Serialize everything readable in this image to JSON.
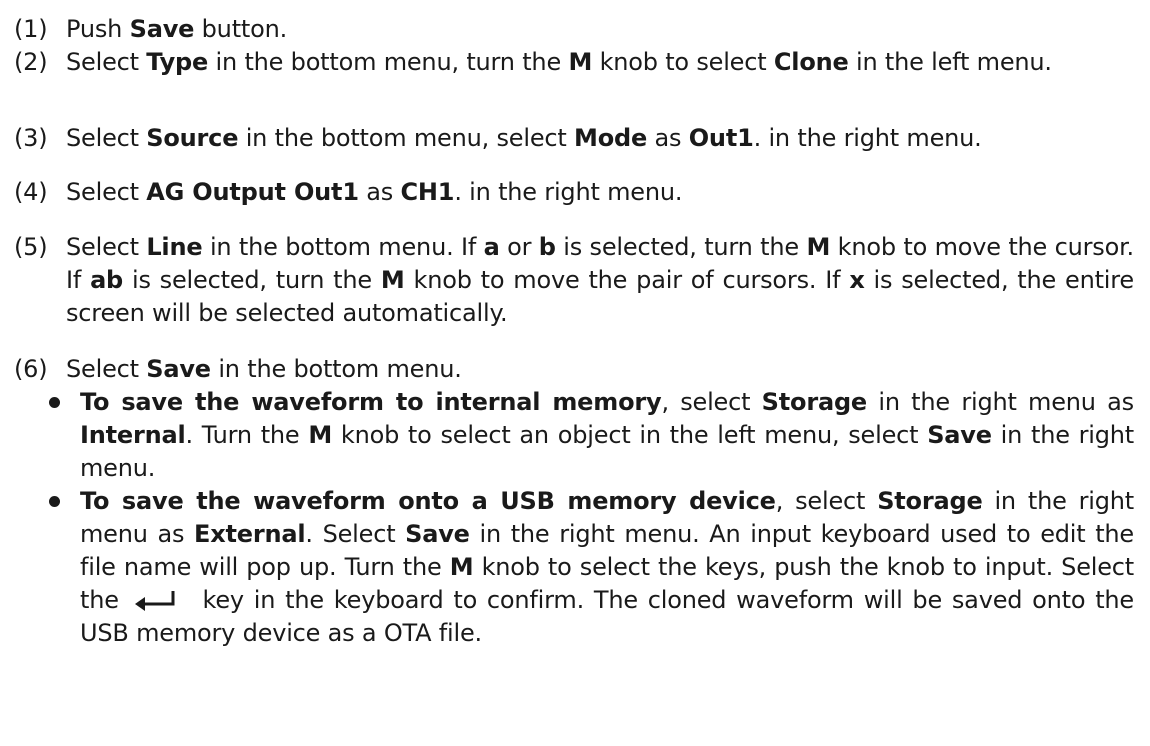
{
  "steps": [
    {
      "num": "(1)",
      "parts": [
        "Push ",
        "Save",
        " button."
      ]
    },
    {
      "num": "(2)",
      "parts": [
        "Select ",
        "Type",
        " in the bottom menu, turn the ",
        "M",
        " knob to select ",
        "Clone",
        " in the left menu."
      ]
    },
    {
      "num": "(3)",
      "parts": [
        "Select ",
        "Source",
        " in the bottom menu, select ",
        "Mode",
        " as ",
        "Out1",
        ". in the right menu."
      ]
    },
    {
      "num": "(4)",
      "parts": [
        "Select ",
        "AG Output Out1",
        " as ",
        "CH1",
        ". in the right menu."
      ]
    },
    {
      "num": "(5)",
      "parts": [
        "Select ",
        "Line",
        " in the bottom menu. If ",
        "a",
        " or ",
        "b",
        " is selected, turn the ",
        "M",
        " knob to move the cursor. If ",
        "ab",
        " is selected, turn the ",
        "M",
        " knob to move the pair of cursors. If ",
        "x",
        " is selected, the entire screen will be selected automatically."
      ]
    },
    {
      "num": "(6)",
      "parts": [
        "Select ",
        "Save",
        " in the bottom menu."
      ],
      "bullets": [
        {
          "parts": [
            "To save the waveform to internal memory",
            ", select ",
            "Storage",
            " in the right menu as ",
            "Internal",
            ". Turn the ",
            "M",
            " knob to select an object in the left menu, select ",
            "Save",
            " in the right menu."
          ]
        },
        {
          "parts": [
            "To save the waveform onto a USB memory device",
            ", select ",
            "Storage",
            " in the right menu as ",
            "External",
            ". Select ",
            "Save",
            " in the right menu. An input keyboard used to edit the file name will pop up. Turn the ",
            "M",
            " knob to select the keys, push the knob to input. Select the ",
            " key in the keyboard to confirm. The cloned waveform will be saved onto the USB memory device as a OTA file."
          ]
        }
      ]
    }
  ],
  "icons": {
    "enter_key": "enter-key-icon"
  }
}
